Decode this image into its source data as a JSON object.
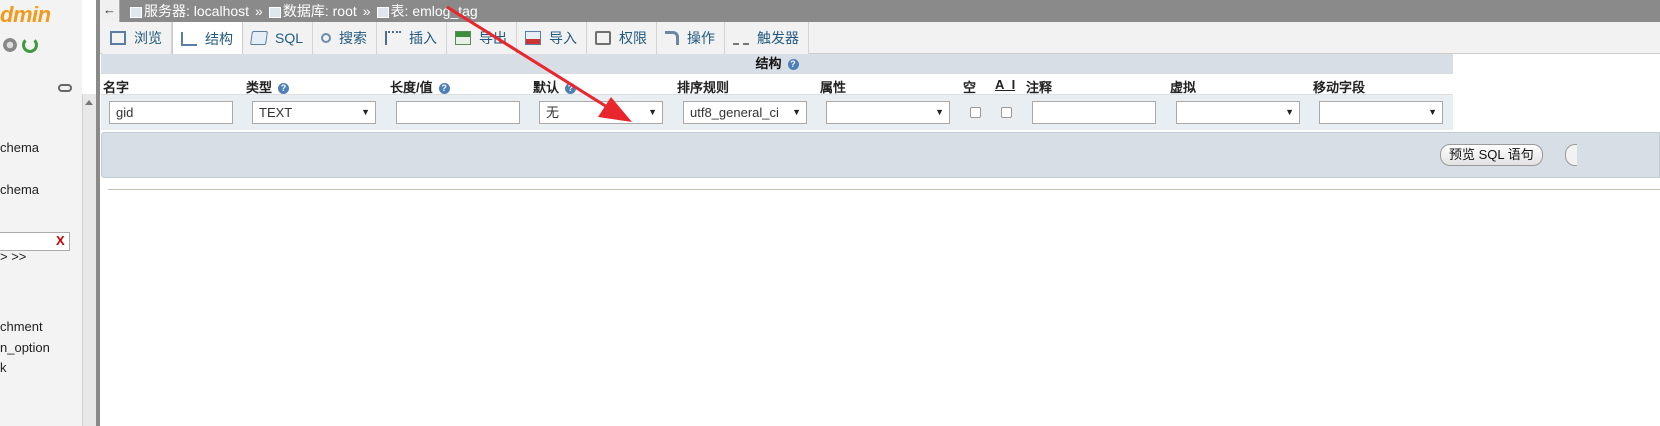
{
  "nav": {
    "logo": "dmin",
    "lines": [
      "chema",
      "chema",
      "> >>",
      "chment",
      "n_option",
      "k"
    ],
    "filter_clear": "X"
  },
  "topbar": {
    "back": "←",
    "breadcrumb": [
      {
        "label": "服务器: localhost",
        "icon": "server-icon"
      },
      {
        "label": "数据库: root",
        "icon": "database-icon"
      },
      {
        "label": "表: emlog_tag",
        "icon": "table-icon"
      }
    ],
    "separator": "»"
  },
  "tabs": [
    {
      "label": "浏览",
      "icon": "browse-icon",
      "active": false
    },
    {
      "label": "结构",
      "icon": "structure-icon",
      "active": true
    },
    {
      "label": "SQL",
      "icon": "sql-icon",
      "active": false
    },
    {
      "label": "搜索",
      "icon": "search-icon",
      "active": false
    },
    {
      "label": "插入",
      "icon": "insert-icon",
      "active": false
    },
    {
      "label": "导出",
      "icon": "export-icon",
      "active": false
    },
    {
      "label": "导入",
      "icon": "import-icon",
      "active": false
    },
    {
      "label": "权限",
      "icon": "privileges-icon",
      "active": false
    },
    {
      "label": "操作",
      "icon": "operations-icon",
      "active": false
    },
    {
      "label": "触发器",
      "icon": "triggers-icon",
      "active": false
    }
  ],
  "structure": {
    "caption": "结构",
    "help": "?",
    "headers": {
      "name": "名字",
      "type": "类型",
      "length": "长度/值",
      "default": "默认",
      "collation": "排序规则",
      "attributes": "属性",
      "null": "空",
      "ai": "A_I",
      "comment": "注释",
      "virtual": "虚拟",
      "move": "移动字段"
    },
    "row": {
      "name": "gid",
      "type": "TEXT",
      "length": "",
      "default": "无",
      "collation": "utf8_general_ci",
      "attributes": "",
      "null": false,
      "ai": false,
      "comment": "",
      "virtual": "",
      "move": ""
    }
  },
  "preview": {
    "button": "预览 SQL 语句"
  },
  "colors": {
    "topbar": "#8a8a8a",
    "tab_text": "#235a81",
    "caption_bg": "#d7dee5",
    "row_bg": "#e9eef2",
    "arrow": "#e8262c",
    "logo": "#f29b1b"
  }
}
